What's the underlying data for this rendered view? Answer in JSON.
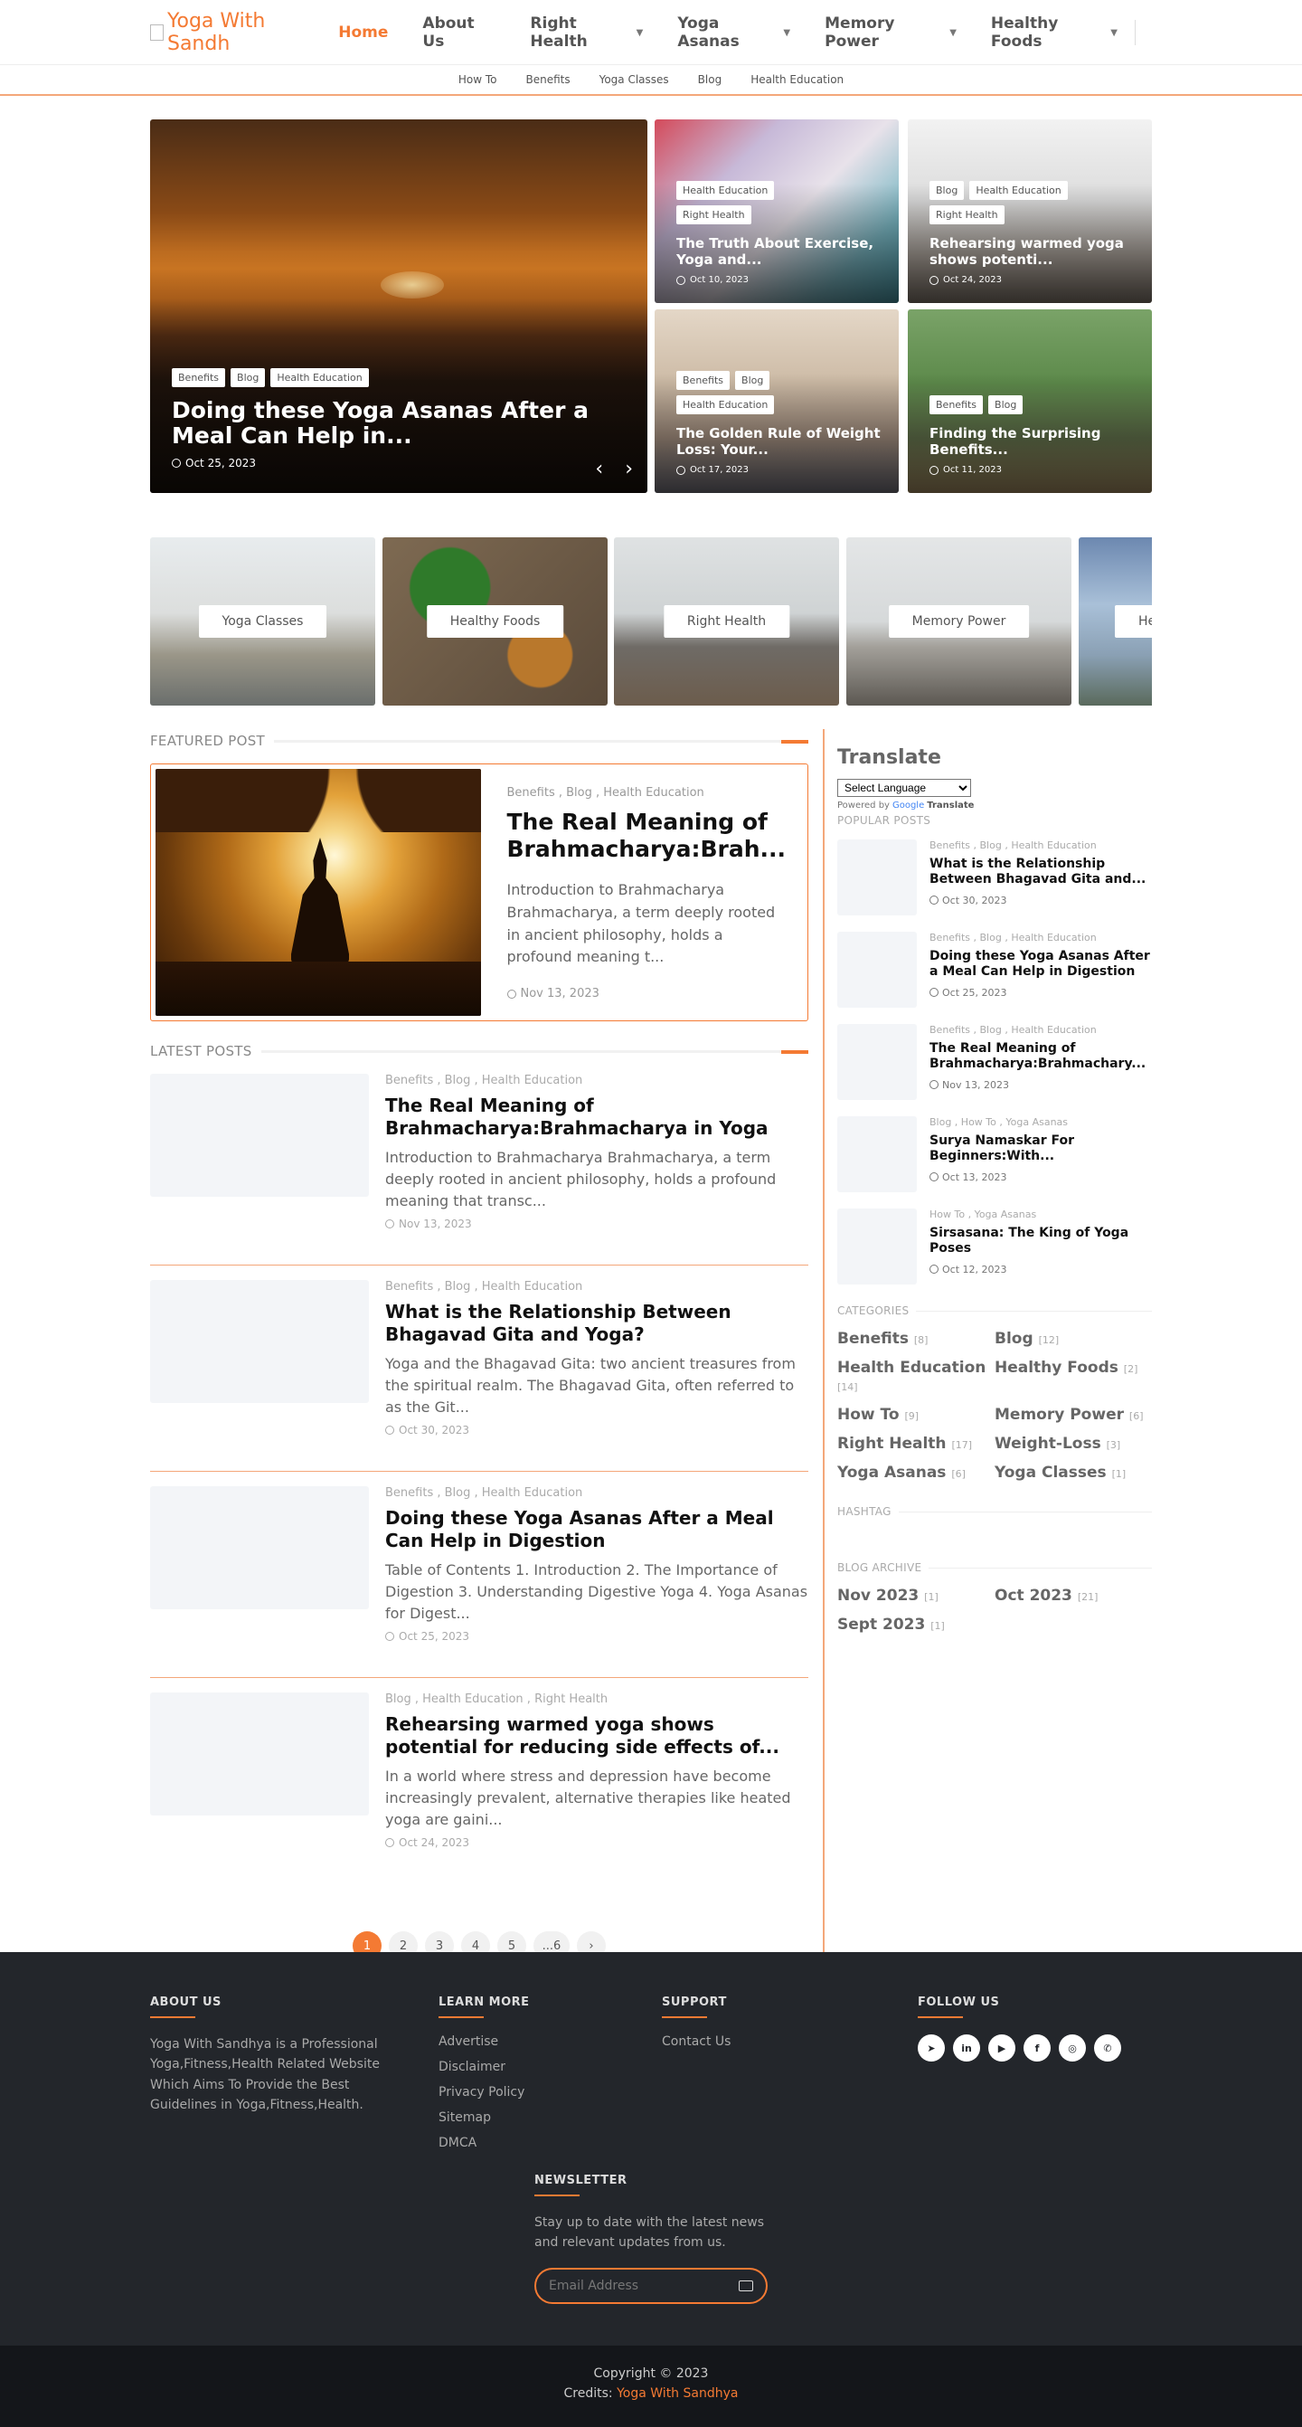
{
  "header": {
    "logo_text": "Yoga With Sandh",
    "nav": [
      {
        "label": "Home",
        "active": true
      },
      {
        "label": "About Us"
      },
      {
        "label": "Right Health",
        "dropdown": true
      },
      {
        "label": "Yoga Asanas",
        "dropdown": true
      },
      {
        "label": "Memory Power",
        "dropdown": true
      },
      {
        "label": "Healthy Foods",
        "dropdown": true
      }
    ],
    "subnav": [
      "How To",
      "Benefits",
      "Yoga Classes",
      "Blog",
      "Health Education"
    ]
  },
  "hero": {
    "main": {
      "tags": [
        "Benefits",
        "Blog",
        "Health Education"
      ],
      "title": "Doing these Yoga Asanas After a Meal Can Help in...",
      "date": "Oct 25, 2023"
    },
    "small": [
      {
        "tags": [
          "Health Education",
          "Right Health"
        ],
        "title": "The Truth About Exercise, Yoga and...",
        "date": "Oct 10, 2023"
      },
      {
        "tags": [
          "Blog",
          "Health Education",
          "Right Health"
        ],
        "title": "Rehearsing warmed yoga shows potenti...",
        "date": "Oct 24, 2023"
      },
      {
        "tags": [
          "Benefits",
          "Blog",
          "Health Education"
        ],
        "title": "The Golden Rule of Weight Loss: Your...",
        "date": "Oct 17, 2023"
      },
      {
        "tags": [
          "Benefits",
          "Blog"
        ],
        "title": "Finding the Surprising Benefits...",
        "date": "Oct 11, 2023"
      }
    ]
  },
  "categories_carousel": [
    "Yoga Classes",
    "Healthy Foods",
    "Right Health",
    "Memory Power",
    "Hea"
  ],
  "featured": {
    "heading": "FEATURED POST",
    "cats": "Benefits , Blog , Health Education",
    "title": "The Real Meaning of Brahmacharya:Brah...",
    "excerpt": "Introduction to Brahmacharya Brahmacharya, a term deeply rooted in ancient philosophy, holds a profound meaning t...",
    "date": "Nov 13, 2023"
  },
  "latest": {
    "heading": "LATEST POSTS",
    "posts": [
      {
        "cats": "Benefits , Blog , Health Education",
        "title": "The Real Meaning of Brahmacharya:Brahmacharya in Yoga",
        "excerpt": "Introduction to Brahmacharya Brahmacharya, a term deeply rooted in ancient philosophy, holds a profound meaning that transc...",
        "date": "Nov 13, 2023"
      },
      {
        "cats": "Benefits , Blog , Health Education",
        "title": "What is the Relationship Between Bhagavad Gita and Yoga?",
        "excerpt": "Yoga and the Bhagavad Gita: two ancient treasures from the spiritual realm. The Bhagavad Gita, often referred to as the Git...",
        "date": "Oct 30, 2023"
      },
      {
        "cats": "Benefits , Blog , Health Education",
        "title": "Doing these Yoga Asanas After a Meal Can Help in Digestion",
        "excerpt": "Table of Contents 1. Introduction 2. The Importance of Digestion 3. Understanding Digestive Yoga 4. Yoga Asanas for Digest...",
        "date": "Oct 25, 2023"
      },
      {
        "cats": "Blog , Health Education , Right Health",
        "title": "Rehearsing warmed yoga shows potential for reducing side effects of...",
        "excerpt": "In a world where stress and depression have become increasingly prevalent, alternative therapies like heated yoga are gaini...",
        "date": "Oct 24, 2023"
      }
    ]
  },
  "pagination": [
    "1",
    "2",
    "3",
    "4",
    "5",
    "...6",
    "›"
  ],
  "sidebar": {
    "translate_title": "Translate",
    "language_select": "Select Language",
    "powered_by": "Powered by",
    "google": "Google",
    "translate_word": "Translate",
    "popular_heading": "POPULAR POSTS",
    "popular": [
      {
        "cats": "Benefits , Blog , Health Education",
        "title": "What is the Relationship Between Bhagavad Gita and...",
        "date": "Oct 30, 2023"
      },
      {
        "cats": "Benefits , Blog , Health Education",
        "title": "Doing these Yoga Asanas After a Meal Can Help in Digestion",
        "date": "Oct 25, 2023"
      },
      {
        "cats": "Benefits , Blog , Health Education",
        "title": "The Real Meaning of Brahmacharya:Brahmachary...",
        "date": "Nov 13, 2023"
      },
      {
        "cats": "Blog , How To , Yoga Asanas",
        "title": "Surya Namaskar For Beginners:With...",
        "date": "Oct 13, 2023"
      },
      {
        "cats": "How To , Yoga Asanas",
        "title": "Sirsasana: The King of Yoga Poses",
        "date": "Oct 12, 2023"
      }
    ],
    "categories_heading": "CATEGORIES",
    "categories": [
      {
        "name": "Benefits",
        "count": "[8]"
      },
      {
        "name": "Blog",
        "count": "[12]"
      },
      {
        "name": "Health Education",
        "count": "[14]"
      },
      {
        "name": "Healthy Foods",
        "count": "[2]"
      },
      {
        "name": "How To",
        "count": "[9]"
      },
      {
        "name": "Memory Power",
        "count": "[6]"
      },
      {
        "name": "Right Health",
        "count": "[17]"
      },
      {
        "name": "Weight-Loss",
        "count": "[3]"
      },
      {
        "name": "Yoga Asanas",
        "count": "[6]"
      },
      {
        "name": "Yoga Classes",
        "count": "[1]"
      }
    ],
    "hashtag_heading": "HASHTAG",
    "archive_heading": "BLOG ARCHIVE",
    "archive": [
      {
        "name": "Nov 2023",
        "count": "[1]"
      },
      {
        "name": "Oct 2023",
        "count": "[21]"
      },
      {
        "name": "Sept 2023",
        "count": "[1]"
      }
    ]
  },
  "footer": {
    "about_title": "ABOUT US",
    "about_text": "Yoga With Sandhya is a Professional Yoga,Fitness,Health Related Website Which Aims To Provide the Best Guidelines in Yoga,Fitness,Health.",
    "learn_title": "LEARN MORE",
    "learn_links": [
      "Advertise",
      "Disclaimer",
      "Privacy Policy",
      "Sitemap",
      "DMCA"
    ],
    "support_title": "SUPPORT",
    "support_links": [
      "Contact Us"
    ],
    "follow_title": "FOLLOW US",
    "social_icons": [
      "telegram-icon",
      "linkedin-icon",
      "youtube-icon",
      "facebook-icon",
      "instagram-icon",
      "whatsapp-icon"
    ],
    "newsletter_title": "NEWSLETTER",
    "newsletter_text": "Stay up to date with the latest news and relevant updates from us.",
    "email_placeholder": "Email Address",
    "copyright": "Copyright © 2023",
    "credits_label": "Credits:",
    "credits_name": "Yoga With Sandhya"
  },
  "colors": {
    "accent": "#f47a33",
    "footer_bg": "#23262b",
    "bottom_bg": "#14161a"
  }
}
